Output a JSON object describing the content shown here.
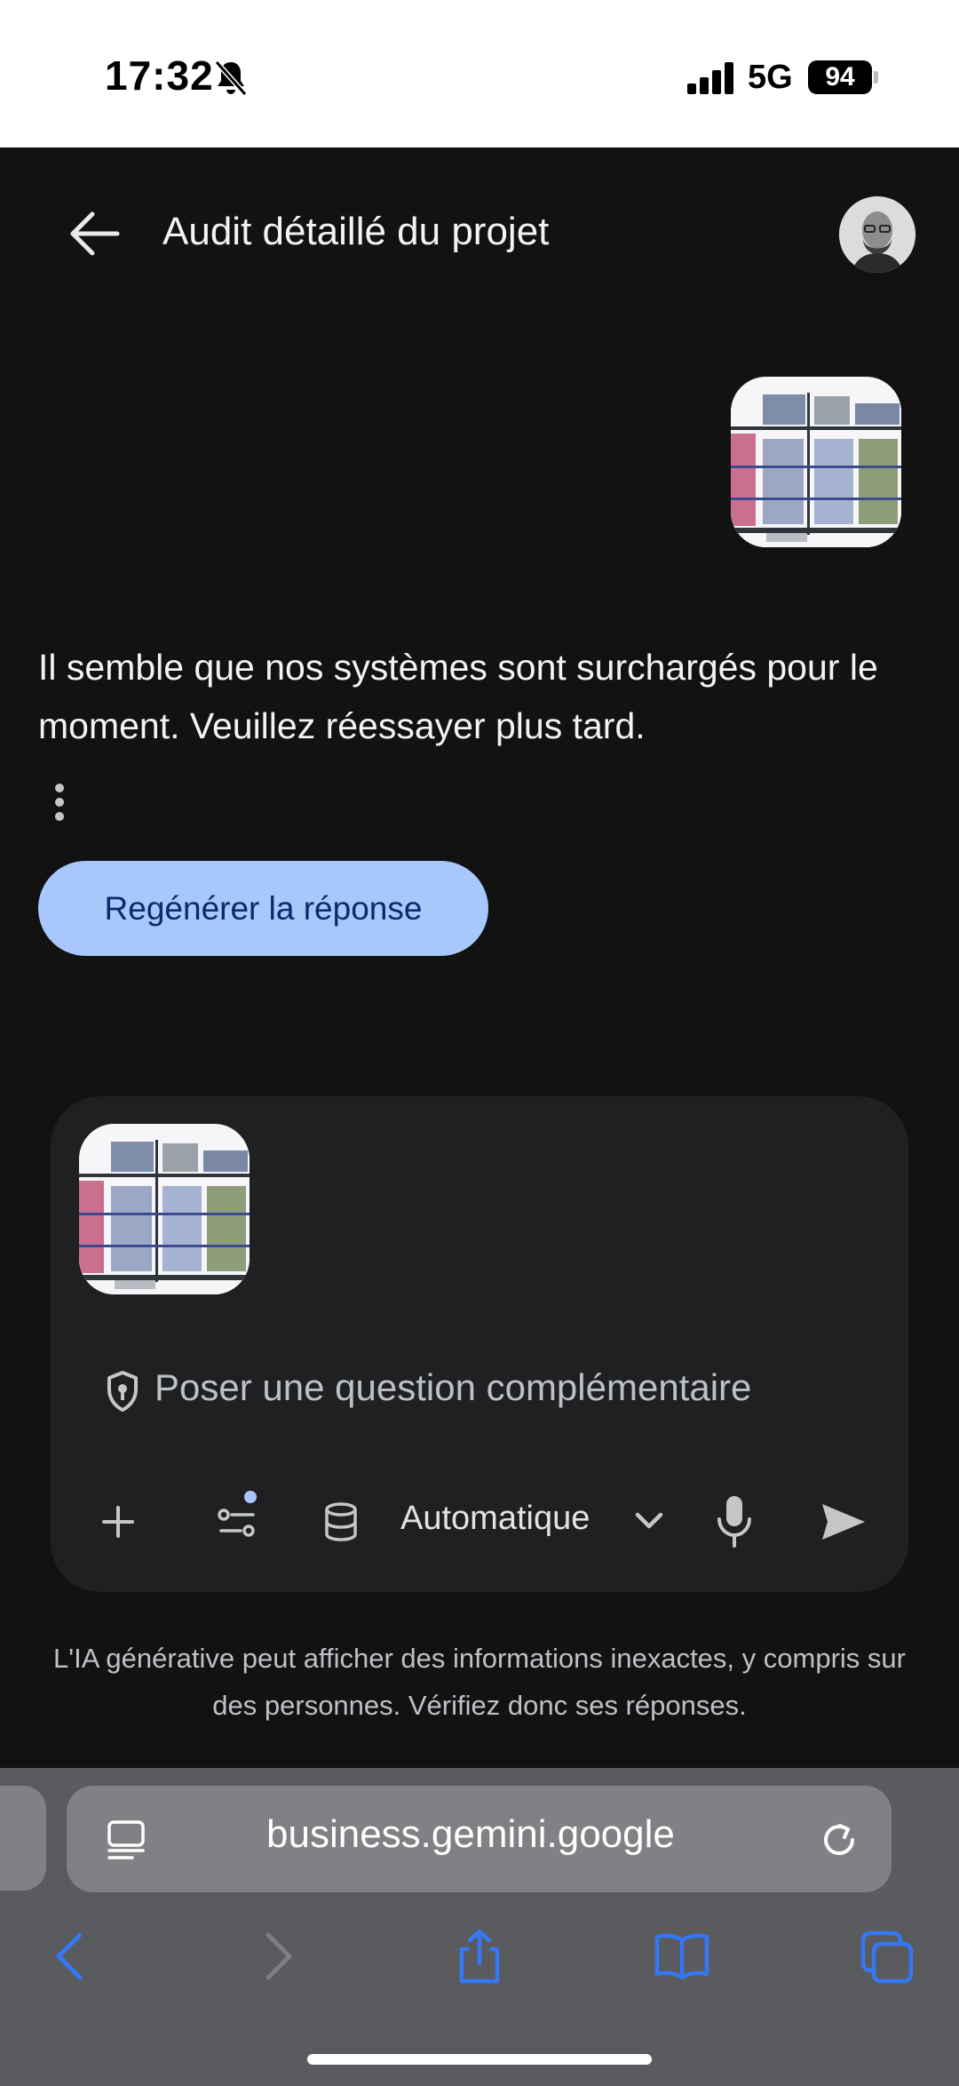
{
  "status_bar": {
    "time": "17:32",
    "network": "5G",
    "battery": "94",
    "icons": [
      "bell-off-icon",
      "signal-icon",
      "battery-icon"
    ]
  },
  "header": {
    "title": "Audit détaillé du projet",
    "icons": [
      "back-arrow-icon",
      "user-avatar"
    ]
  },
  "conversation": {
    "assistant_reply": "Il semble que nos systèmes sont surchargés pour le moment. Veuillez réessayer plus tard.",
    "regenerate_label": "Regénérer la réponse"
  },
  "composer": {
    "placeholder": "Poser une question complémentaire",
    "model_label": "Automatique",
    "icons": [
      "shield-icon",
      "plus-icon",
      "tools-icon",
      "database-icon",
      "chevron-down-icon",
      "microphone-icon",
      "send-icon"
    ]
  },
  "disclaimer": "L'IA générative peut afficher des informations inexactes, y compris sur des personnes. Vérifiez donc ses réponses.",
  "browser": {
    "url": "business.gemini.google",
    "icons": [
      "reader-icon",
      "reload-icon",
      "nav-back-icon",
      "nav-forward-icon",
      "share-icon",
      "bookmarks-icon",
      "tabs-icon"
    ]
  },
  "colors": {
    "background": "#121213",
    "regen_button": "#a8c7fa",
    "composer_bg": "#1f2022",
    "accent_blue": "#3478f6",
    "tools_dot": "#a8c7fa"
  }
}
